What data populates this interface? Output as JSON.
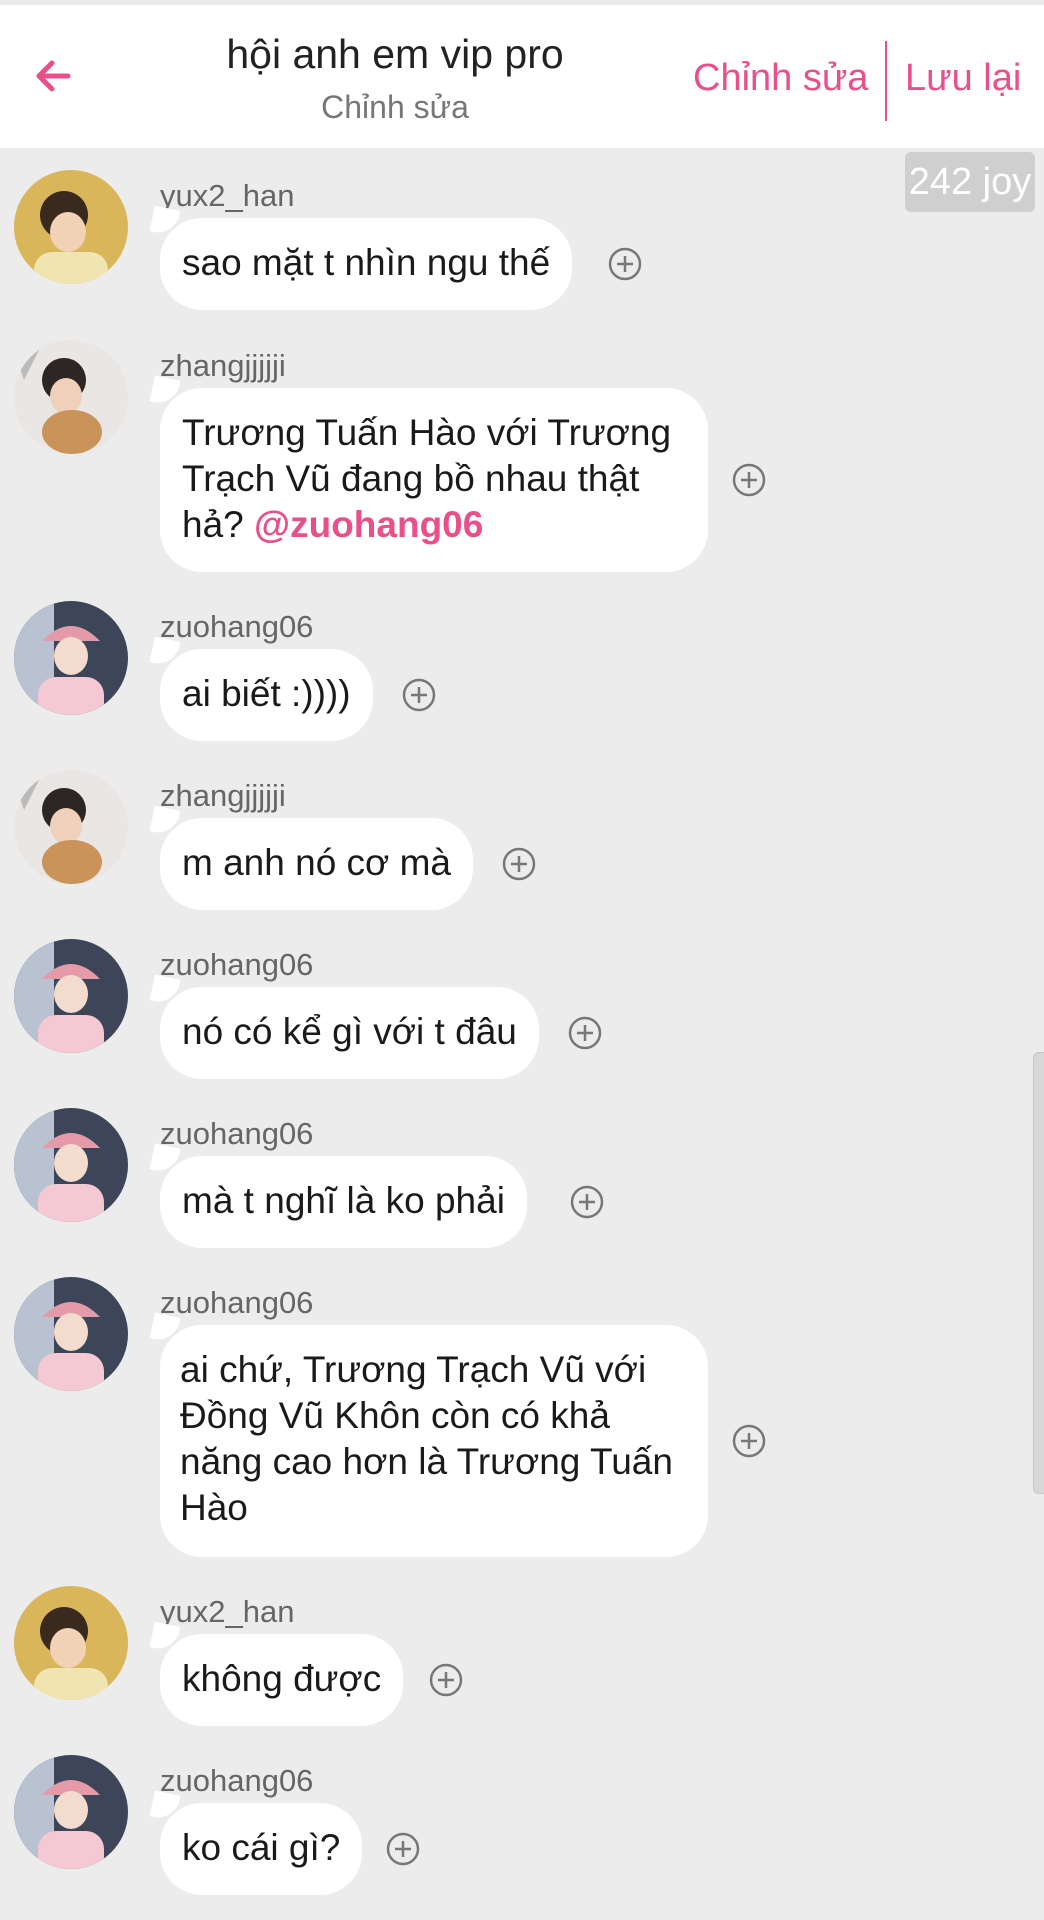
{
  "header": {
    "title": "hội anh em vip pro",
    "subtitle": "Chỉnh sửa",
    "edit_label": "Chỉnh sửa",
    "save_label": "Lưu lại"
  },
  "badge": {
    "text": "242 joy"
  },
  "colors": {
    "accent": "#e94f8b",
    "background": "#ececec",
    "bubble": "#ffffff"
  },
  "messages": [
    {
      "user": "yux2_han",
      "text": "sao mặt t nhìn ngu thế"
    },
    {
      "user": "zhangjjjjji",
      "text": "Trương Tuấn Hào với Trương Trạch Vũ đang bồ nhau thật hả?",
      "mention": "@zuohang06"
    },
    {
      "user": "zuohang06",
      "text": "ai biết :))))"
    },
    {
      "user": "zhangjjjjji",
      "text": "m anh nó cơ mà"
    },
    {
      "user": "zuohang06",
      "text": "nó có kể gì với t đâu"
    },
    {
      "user": "zuohang06",
      "text": "mà t nghĩ là ko phải"
    },
    {
      "user": "zuohang06",
      "text": "ai chứ, Trương Trạch Vũ với Đồng Vũ Khôn còn có khả năng cao hơn là Trương Tuấn Hào"
    },
    {
      "user": "yux2_han",
      "text": "không được"
    },
    {
      "user": "zuohang06",
      "text": "ko cái gì?"
    }
  ]
}
